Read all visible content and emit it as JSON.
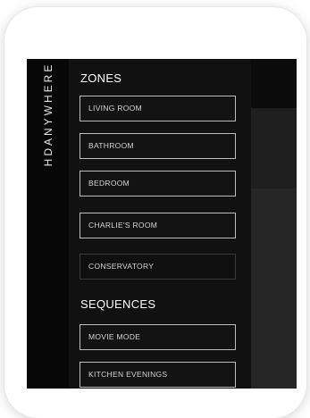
{
  "brand": {
    "name": "HDANYWHERE"
  },
  "menu": {
    "zones_title": "ZONES",
    "zones": [
      {
        "label": "LIVING ROOM"
      },
      {
        "label": "BATHROOM"
      },
      {
        "label": "BEDROOM"
      },
      {
        "label": "CHARLIE'S ROOM"
      },
      {
        "label": "CONSERVATORY"
      }
    ],
    "sequences_title": "SEQUENCES",
    "sequences": [
      {
        "label": "MOVIE MODE"
      },
      {
        "label": "KITCHEN EVENINGS"
      }
    ]
  }
}
